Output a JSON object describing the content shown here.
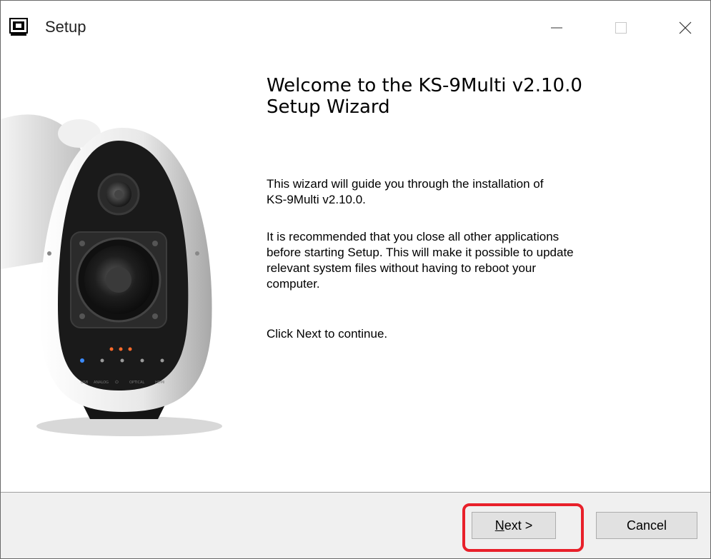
{
  "window": {
    "title": "Setup",
    "icons": {
      "app": "installer-icon",
      "minimize": "minimize-icon",
      "maximize": "maximize-icon",
      "close": "close-icon"
    }
  },
  "wizard": {
    "heading_line1": "Welcome to the KS-9Multi v2.10.0",
    "heading_line2": "Setup Wizard",
    "paragraph1_line1": "This wizard will guide you through the installation of",
    "paragraph1_line2": "KS-9Multi v2.10.0.",
    "paragraph2_line1": "It is recommended that you close all other applications",
    "paragraph2_line2": "before starting Setup. This will make it possible to update",
    "paragraph2_line3": "relevant system files without having to reboot your",
    "paragraph2_line4": "computer.",
    "paragraph3": "Click Next to continue.",
    "speaker_labels": [
      "USB",
      "ANALOG",
      "⏻",
      "OPTICAL",
      "HDMI"
    ]
  },
  "buttons": {
    "next_mnemonic": "N",
    "next_rest": "ext >",
    "cancel": "Cancel"
  },
  "colors": {
    "highlight": "#e8202a",
    "led_blue": "#3b8bff",
    "led_orange": "#ff6a2a"
  }
}
